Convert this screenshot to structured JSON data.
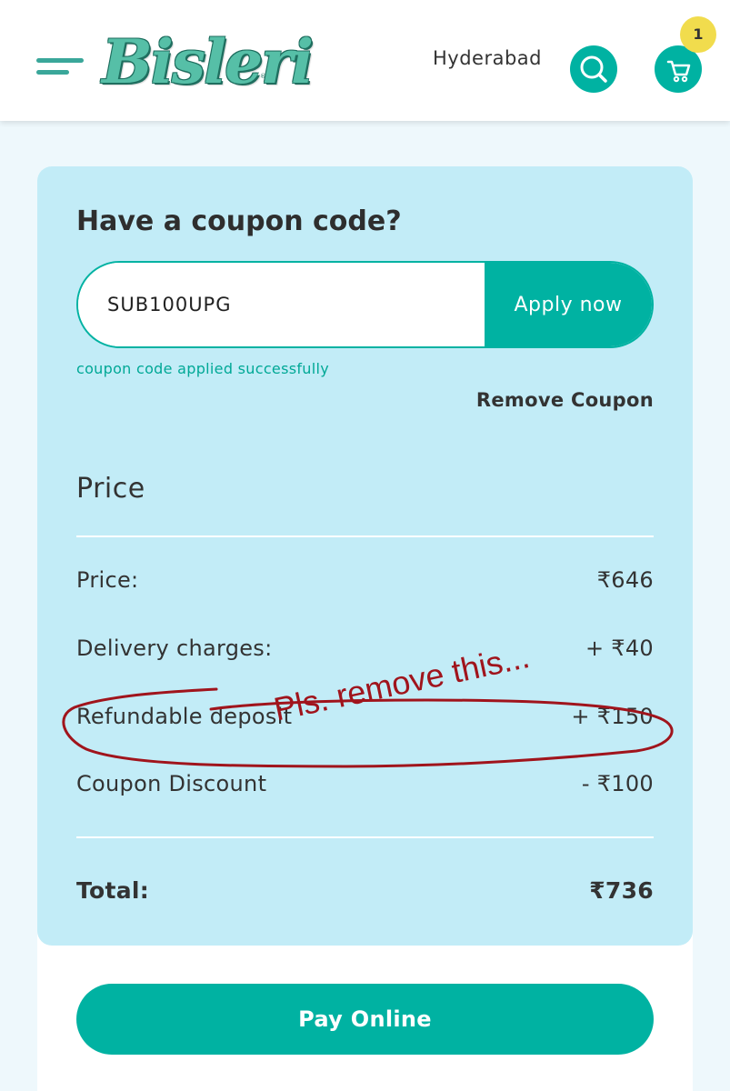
{
  "header": {
    "logo_text": "Bisleri",
    "logo_mark": "®",
    "city": "Hyderabad",
    "cart_count": "1",
    "icons": {
      "menu": "hamburger-menu-icon",
      "search": "search-icon",
      "cart": "cart-icon"
    }
  },
  "coupon": {
    "title": "Have a coupon code?",
    "input_value": "SUB100UPG",
    "apply_label": "Apply now",
    "success_message": "coupon code applied successfully",
    "remove_label": "Remove Coupon"
  },
  "price": {
    "heading": "Price",
    "rows": [
      {
        "label": "Price:",
        "value": "₹646"
      },
      {
        "label": "Delivery charges:",
        "value": "+ ₹40"
      },
      {
        "label": "Refundable deposit",
        "value": "+ ₹150"
      },
      {
        "label": "Coupon Discount",
        "value": "- ₹100"
      }
    ],
    "total_label": "Total:",
    "total_value": "₹736"
  },
  "annotation": {
    "text": "Pls. remove this..."
  },
  "actions": {
    "pay_label": "Pay Online"
  },
  "colors": {
    "accent": "#00b2a2",
    "card_bg": "#c2ecf7",
    "badge": "#f1dc4d",
    "annotation": "#a0141c"
  }
}
